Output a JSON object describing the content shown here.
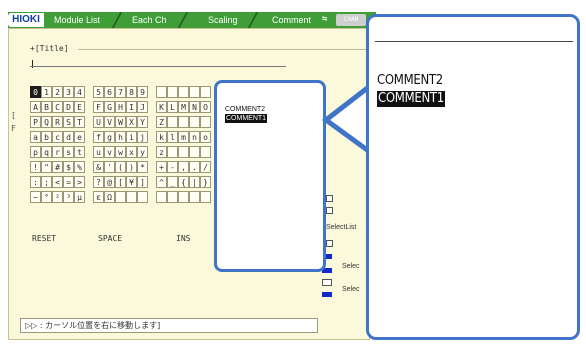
{
  "tabs": {
    "logo": "HIOKI",
    "items": [
      "Module List",
      "Each Ch",
      "Scaling",
      "Comment"
    ],
    "active": "Comment",
    "chan_label": "CHAN"
  },
  "editor": {
    "title_label": "+[Title]",
    "cursor_glyph": "",
    "left_edge_chars": [
      "[",
      "F"
    ]
  },
  "keyboard": {
    "rows": [
      [
        "0",
        "1",
        "2",
        "3",
        "4",
        "",
        "5",
        "6",
        "7",
        "8",
        "9",
        "",
        "",
        "",
        "",
        "",
        "",
        "",
        ""
      ],
      [
        "A",
        "B",
        "C",
        "D",
        "E",
        "",
        "F",
        "G",
        "H",
        "I",
        "J",
        "",
        "K",
        "L",
        "M",
        "N",
        "O"
      ],
      [
        "P",
        "Q",
        "R",
        "S",
        "T",
        "",
        "U",
        "V",
        "W",
        "X",
        "Y",
        "",
        "Z",
        "",
        "",
        "",
        ""
      ],
      [
        "a",
        "b",
        "c",
        "d",
        "e",
        "",
        "f",
        "g",
        "h",
        "i",
        "j",
        "",
        "k",
        "l",
        "m",
        "n",
        "o"
      ],
      [
        "p",
        "q",
        "r",
        "s",
        "t",
        "",
        "u",
        "v",
        "w",
        "x",
        "y",
        "",
        "z",
        "",
        "",
        "",
        ""
      ],
      [
        "!",
        "\"",
        "#",
        "$",
        "%",
        "",
        "&",
        "'",
        "(",
        ")",
        "*",
        "",
        "+",
        "-",
        ",",
        ".",
        "/"
      ],
      [
        ":",
        ";",
        "<",
        "=",
        ">",
        "",
        "?",
        "@",
        "[",
        "¥",
        "]",
        "",
        "^",
        "_",
        "{",
        "|",
        "}"
      ],
      [
        "~",
        "°",
        "²",
        "³",
        "μ",
        "",
        "ε",
        "Ω",
        "",
        "",
        "",
        "",
        "",
        "",
        "",
        "",
        ""
      ]
    ],
    "selected_key": "0",
    "actions": [
      "RESET",
      "SPACE",
      "INS"
    ]
  },
  "side_labels": {
    "select_list": "SelectList",
    "select_a": "Selec",
    "select_b": "Selec"
  },
  "hint": "▷▷ : カーソル位置を右に移動します]",
  "comment_list": {
    "items": [
      "COMMENT2",
      "COMMENT1"
    ],
    "selected": "COMMENT1"
  },
  "colors": {
    "tab_bar": "#3f9e38",
    "panel_bg": "#fbf9db",
    "callout_border": "#3f74c8",
    "indicator_blue": "#1228c8"
  }
}
